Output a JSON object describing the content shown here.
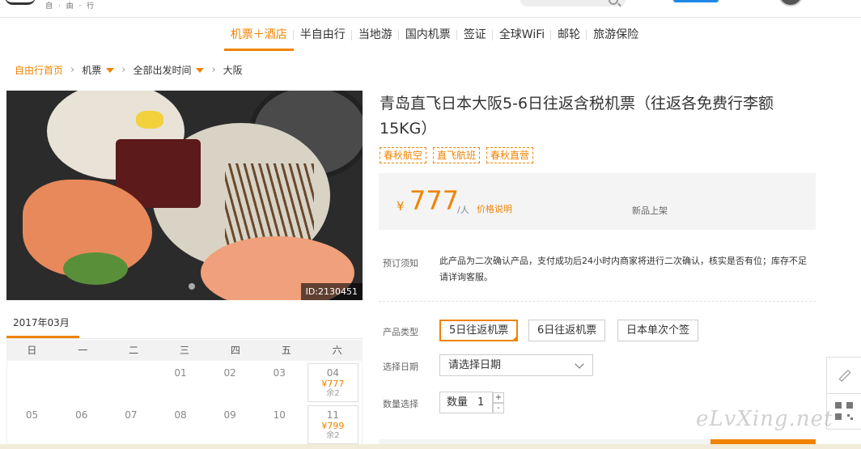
{
  "header": {
    "logo_sub": "自 · 由 · 行"
  },
  "nav": {
    "items": [
      "机票＋酒店",
      "半自由行",
      "当地游",
      "国内机票",
      "签证",
      "全球WiFi",
      "邮轮",
      "旅游保险"
    ],
    "active_index": 0
  },
  "breadcrumb": {
    "home": "自由行首页",
    "flight": "机票",
    "departure": "全部出发时间",
    "destination": "大阪"
  },
  "gallery": {
    "photo_id": "ID:2130451"
  },
  "calendar": {
    "month": "2017年03月",
    "weekdays": [
      "日",
      "一",
      "二",
      "三",
      "四",
      "五",
      "六"
    ],
    "rows": [
      [
        {
          "day": ""
        },
        {
          "day": ""
        },
        {
          "day": ""
        },
        {
          "day": "01"
        },
        {
          "day": "02"
        },
        {
          "day": "03"
        },
        {
          "day": "04",
          "price": "¥777",
          "remain": "余2"
        }
      ],
      [
        {
          "day": "05"
        },
        {
          "day": "06"
        },
        {
          "day": "07"
        },
        {
          "day": "08"
        },
        {
          "day": "09"
        },
        {
          "day": "10"
        },
        {
          "day": "11",
          "price": "¥799",
          "remain": "余2"
        }
      ]
    ]
  },
  "product": {
    "title": "青岛直飞日本大阪5-6日往返含税机票（往返各免费行李额15KG）",
    "tags": [
      "春秋航空",
      "直飞航班",
      "春秋直营"
    ],
    "price_symbol": "¥",
    "price": "777",
    "price_unit": "/人",
    "price_note": "价格说明",
    "status": "新品上架",
    "notice_label": "预订须知",
    "notice_text": "此产品为二次确认产品，支付成功后24小时内商家将进行二次确认，核实是否有位；库存不足请详询客服。",
    "type_label": "产品类型",
    "types": [
      "5日往返机票",
      "6日往返机票",
      "日本单次个签"
    ],
    "date_label": "选择日期",
    "date_placeholder": "请选择日期",
    "qty_label": "数量选择",
    "qty_text": "数量",
    "qty_value": "1",
    "qty_plus": "+",
    "qty_minus": "-"
  },
  "watermark": "eLvXing.net",
  "colors": {
    "accent": "#f08300",
    "text": "#333333",
    "muted": "#888888",
    "panel": "#f4f4f4"
  }
}
